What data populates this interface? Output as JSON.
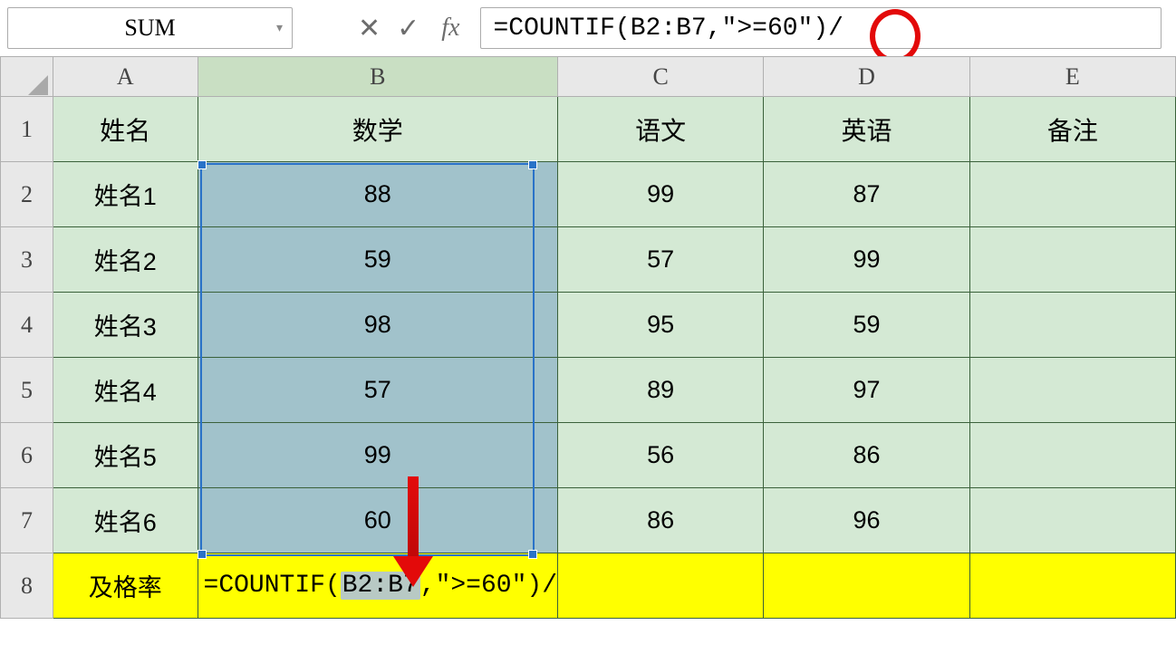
{
  "name_box": "SUM",
  "formula_bar": "=COUNTIF(B2:B7,\">=60\")/",
  "columns": [
    "A",
    "B",
    "C",
    "D",
    "E"
  ],
  "row_numbers": [
    "1",
    "2",
    "3",
    "4",
    "5",
    "6",
    "7",
    "8"
  ],
  "header_row": {
    "A": "姓名",
    "B": "数学",
    "C": "语文",
    "D": "英语",
    "E": "备注"
  },
  "rows": [
    {
      "A": "姓名1",
      "B": "88",
      "C": "99",
      "D": "87",
      "E": ""
    },
    {
      "A": "姓名2",
      "B": "59",
      "C": "57",
      "D": "99",
      "E": ""
    },
    {
      "A": "姓名3",
      "B": "98",
      "C": "95",
      "D": "59",
      "E": ""
    },
    {
      "A": "姓名4",
      "B": "57",
      "C": "89",
      "D": "97",
      "E": ""
    },
    {
      "A": "姓名5",
      "B": "99",
      "C": "56",
      "D": "86",
      "E": ""
    },
    {
      "A": "姓名6",
      "B": "60",
      "C": "86",
      "D": "96",
      "E": ""
    }
  ],
  "summary_row": {
    "A": "及格率",
    "B_prefix": "=COUNTIF(",
    "B_range": "B2:B7",
    "B_suffix": ",\">=60\")/",
    "C": "",
    "D": "",
    "E": ""
  },
  "annotation": {
    "circle_target": "closing-paren-slash",
    "arrow_target": "range-reference"
  }
}
